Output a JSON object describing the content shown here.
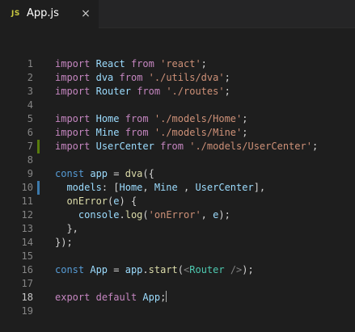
{
  "tab": {
    "icon": "JS",
    "title": "App.js",
    "close": "×"
  },
  "editor": {
    "lines": [
      {
        "n": "1",
        "tokens": [
          [
            "import",
            "k"
          ],
          [
            " ",
            "p"
          ],
          [
            "React",
            "v"
          ],
          [
            " ",
            "p"
          ],
          [
            "from",
            "k"
          ],
          [
            " ",
            "p"
          ],
          [
            "'react'",
            "s"
          ],
          [
            ";",
            "p"
          ]
        ]
      },
      {
        "n": "2",
        "tokens": [
          [
            "import",
            "k"
          ],
          [
            " ",
            "p"
          ],
          [
            "dva",
            "v"
          ],
          [
            " ",
            "p"
          ],
          [
            "from",
            "k"
          ],
          [
            " ",
            "p"
          ],
          [
            "'./utils/dva'",
            "s"
          ],
          [
            ";",
            "p"
          ]
        ]
      },
      {
        "n": "3",
        "tokens": [
          [
            "import",
            "k"
          ],
          [
            " ",
            "p"
          ],
          [
            "Router",
            "v"
          ],
          [
            " ",
            "p"
          ],
          [
            "from",
            "k"
          ],
          [
            " ",
            "p"
          ],
          [
            "'./routes'",
            "s"
          ],
          [
            ";",
            "p"
          ]
        ]
      },
      {
        "n": "4",
        "tokens": []
      },
      {
        "n": "5",
        "tokens": [
          [
            "import",
            "k"
          ],
          [
            " ",
            "p"
          ],
          [
            "Home",
            "v"
          ],
          [
            " ",
            "p"
          ],
          [
            "from",
            "k"
          ],
          [
            " ",
            "p"
          ],
          [
            "'./models/Home'",
            "s"
          ],
          [
            ";",
            "p"
          ]
        ]
      },
      {
        "n": "6",
        "tokens": [
          [
            "import",
            "k"
          ],
          [
            " ",
            "p"
          ],
          [
            "Mine",
            "v"
          ],
          [
            " ",
            "p"
          ],
          [
            "from",
            "k"
          ],
          [
            " ",
            "p"
          ],
          [
            "'./models/Mine'",
            "s"
          ],
          [
            ";",
            "p"
          ]
        ]
      },
      {
        "n": "7",
        "tokens": [
          [
            "import",
            "k"
          ],
          [
            " ",
            "p"
          ],
          [
            "UserCenter",
            "v"
          ],
          [
            " ",
            "p"
          ],
          [
            "from",
            "k"
          ],
          [
            " ",
            "p"
          ],
          [
            "'./models/UserCenter'",
            "s"
          ],
          [
            ";",
            "p"
          ]
        ],
        "gutter": "added"
      },
      {
        "n": "8",
        "tokens": []
      },
      {
        "n": "9",
        "tokens": [
          [
            "const",
            "kb"
          ],
          [
            " ",
            "p"
          ],
          [
            "app",
            "v"
          ],
          [
            " = ",
            "p"
          ],
          [
            "dva",
            "f"
          ],
          [
            "({",
            "p"
          ]
        ]
      },
      {
        "n": "10",
        "tokens": [
          [
            "  ",
            "p"
          ],
          [
            "models",
            "v"
          ],
          [
            ": [",
            "p"
          ],
          [
            "Home",
            "v"
          ],
          [
            ", ",
            "p"
          ],
          [
            "Mine",
            "v"
          ],
          [
            " , ",
            "p"
          ],
          [
            "UserCenter",
            "v"
          ],
          [
            "],",
            "p"
          ]
        ],
        "gutter": "modified"
      },
      {
        "n": "11",
        "tokens": [
          [
            "  ",
            "p"
          ],
          [
            "onError",
            "f"
          ],
          [
            "(",
            "p"
          ],
          [
            "e",
            "v"
          ],
          [
            ") {",
            "p"
          ]
        ]
      },
      {
        "n": "12",
        "tokens": [
          [
            "    ",
            "p"
          ],
          [
            "console",
            "v"
          ],
          [
            ".",
            "p"
          ],
          [
            "log",
            "f"
          ],
          [
            "(",
            "p"
          ],
          [
            "'onError'",
            "s"
          ],
          [
            ", ",
            "p"
          ],
          [
            "e",
            "v"
          ],
          [
            ");",
            "p"
          ]
        ]
      },
      {
        "n": "13",
        "tokens": [
          [
            "  },",
            "p"
          ]
        ]
      },
      {
        "n": "14",
        "tokens": [
          [
            "});",
            "p"
          ]
        ]
      },
      {
        "n": "15",
        "tokens": []
      },
      {
        "n": "16",
        "tokens": [
          [
            "const",
            "kb"
          ],
          [
            " ",
            "p"
          ],
          [
            "App",
            "v"
          ],
          [
            " = ",
            "p"
          ],
          [
            "app",
            "v"
          ],
          [
            ".",
            "p"
          ],
          [
            "start",
            "f"
          ],
          [
            "(",
            "p"
          ],
          [
            "<",
            "tg"
          ],
          [
            "Router",
            "t"
          ],
          [
            " />",
            "tg"
          ],
          [
            ");",
            "p"
          ]
        ]
      },
      {
        "n": "17",
        "tokens": []
      },
      {
        "n": "18",
        "tokens": [
          [
            "export",
            "k"
          ],
          [
            " ",
            "p"
          ],
          [
            "default",
            "k"
          ],
          [
            " ",
            "p"
          ],
          [
            "App",
            "v"
          ],
          [
            ";",
            "p"
          ]
        ],
        "cursor": true
      },
      {
        "n": "19",
        "tokens": []
      }
    ]
  },
  "colors": {
    "background": "#1e1e1e",
    "tab_icon": "#cbcb41",
    "keyword": "#c586c0",
    "storage": "#569cd6",
    "variable": "#9cdcfe",
    "string": "#ce9178",
    "function": "#dcdcaa",
    "component": "#4ec9b0",
    "git_added": "#587c0c",
    "git_modified": "#3c79ab"
  }
}
